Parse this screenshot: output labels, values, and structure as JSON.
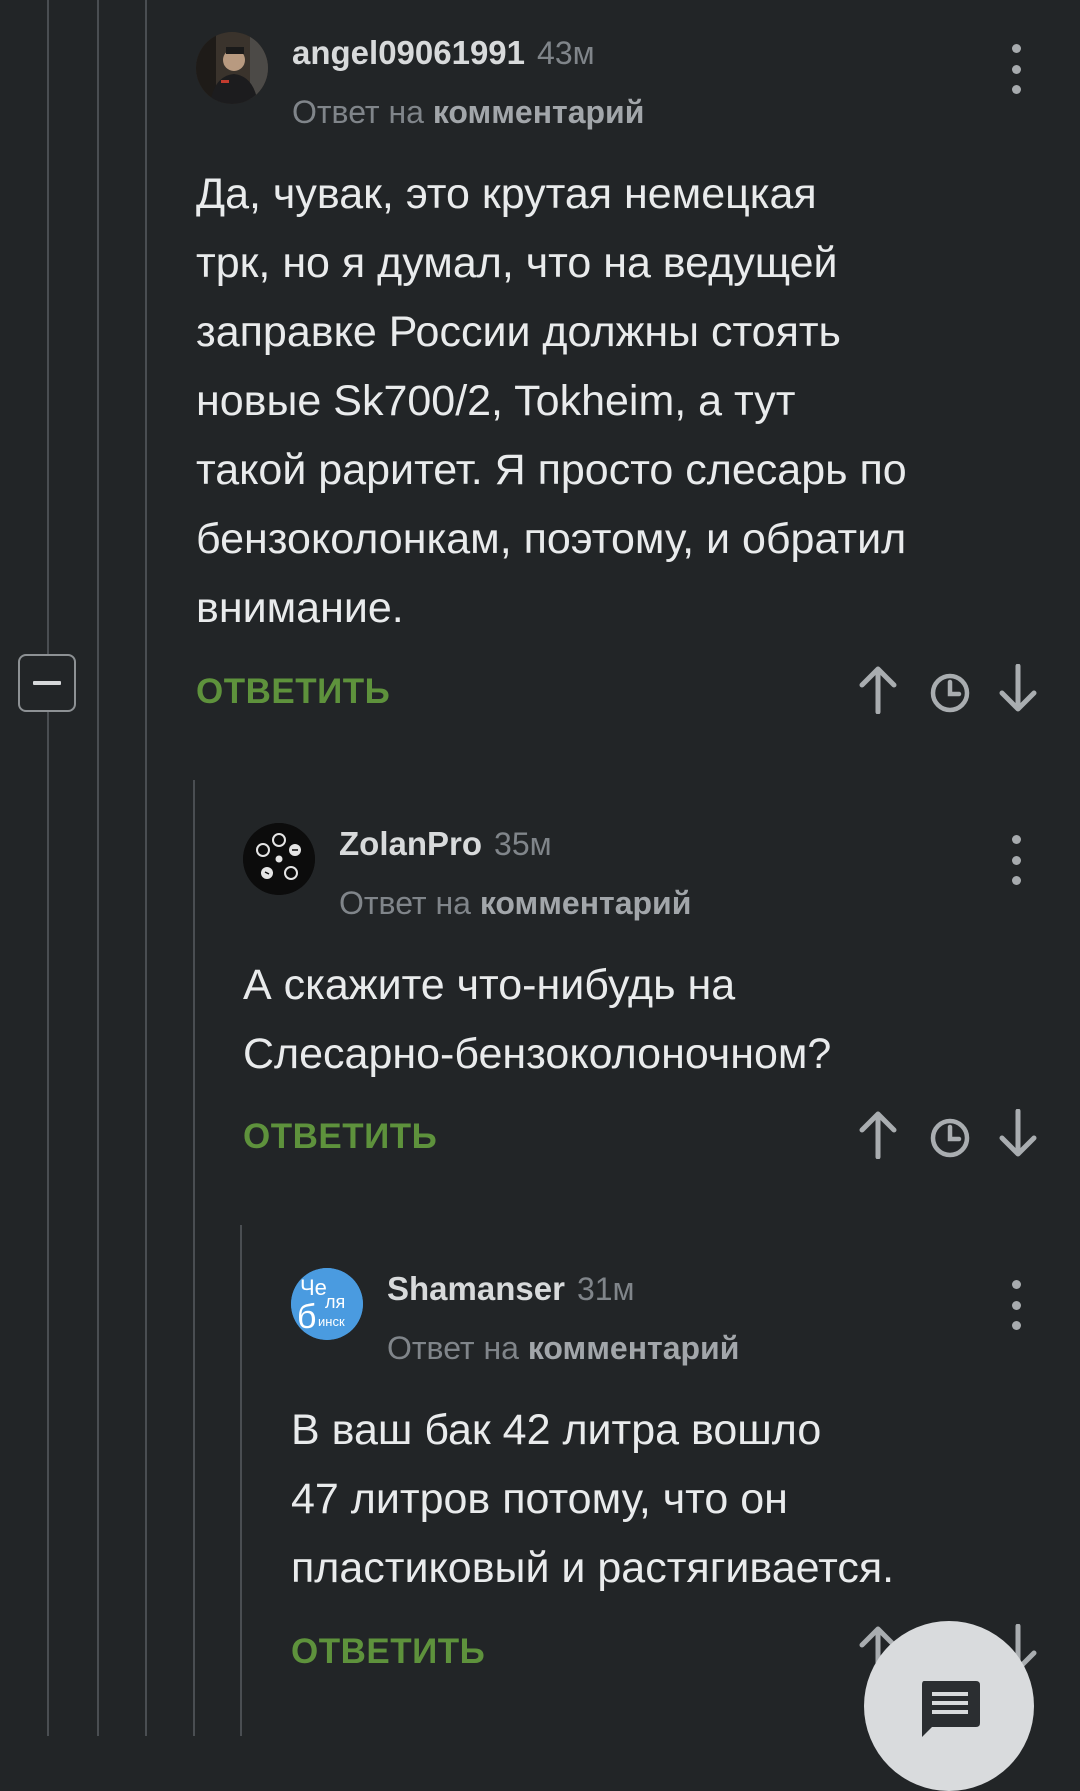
{
  "comments": [
    {
      "username": "angel09061991",
      "time": "43м",
      "reply_prefix": "Ответ на",
      "reply_link": "комментарий",
      "text_lines": [
        "Да, чувак, это крутая немецкая",
        "трк, но я думал, что на ведущей",
        "заправке России должны стоять",
        "новые Sk700/2, Tokheim, а тут",
        "такой раритет. Я просто слесарь по",
        "бензоколонкам, поэтому, и обратил",
        "внимание."
      ],
      "reply_label": "ОТВЕТИТЬ"
    },
    {
      "username": "ZolanPro",
      "time": "35м",
      "reply_prefix": "Ответ на",
      "reply_link": "комментарий",
      "text_lines": [
        "А скажите что-нибудь на",
        "Слесарно-бензоколоночном?"
      ],
      "reply_label": "ОТВЕТИТЬ"
    },
    {
      "username": "Shamanser",
      "time": "31м",
      "reply_prefix": "Ответ на",
      "reply_link": "комментарий",
      "avatar_text": {
        "line1": "Че",
        "line2": "ля",
        "line3": "б",
        "line4": "инск"
      },
      "text_lines": [
        "В ваш бак 42 литра вошло",
        "47 литров потому, что он",
        "пластиковый и растягивается."
      ],
      "reply_label": "ОТВЕТИТЬ"
    }
  ],
  "icons": {
    "vote_up": "arrow-up-icon",
    "save": "clock-icon",
    "vote_down": "arrow-down-icon",
    "menu": "more-vertical-icon",
    "collapse": "minus-icon",
    "fab": "comment-icon"
  },
  "colors": {
    "background": "#222527",
    "reply_green": "#5e923c",
    "text": "#e9ebec",
    "muted": "#80858a",
    "avatar_blue": "#4a9be0"
  }
}
